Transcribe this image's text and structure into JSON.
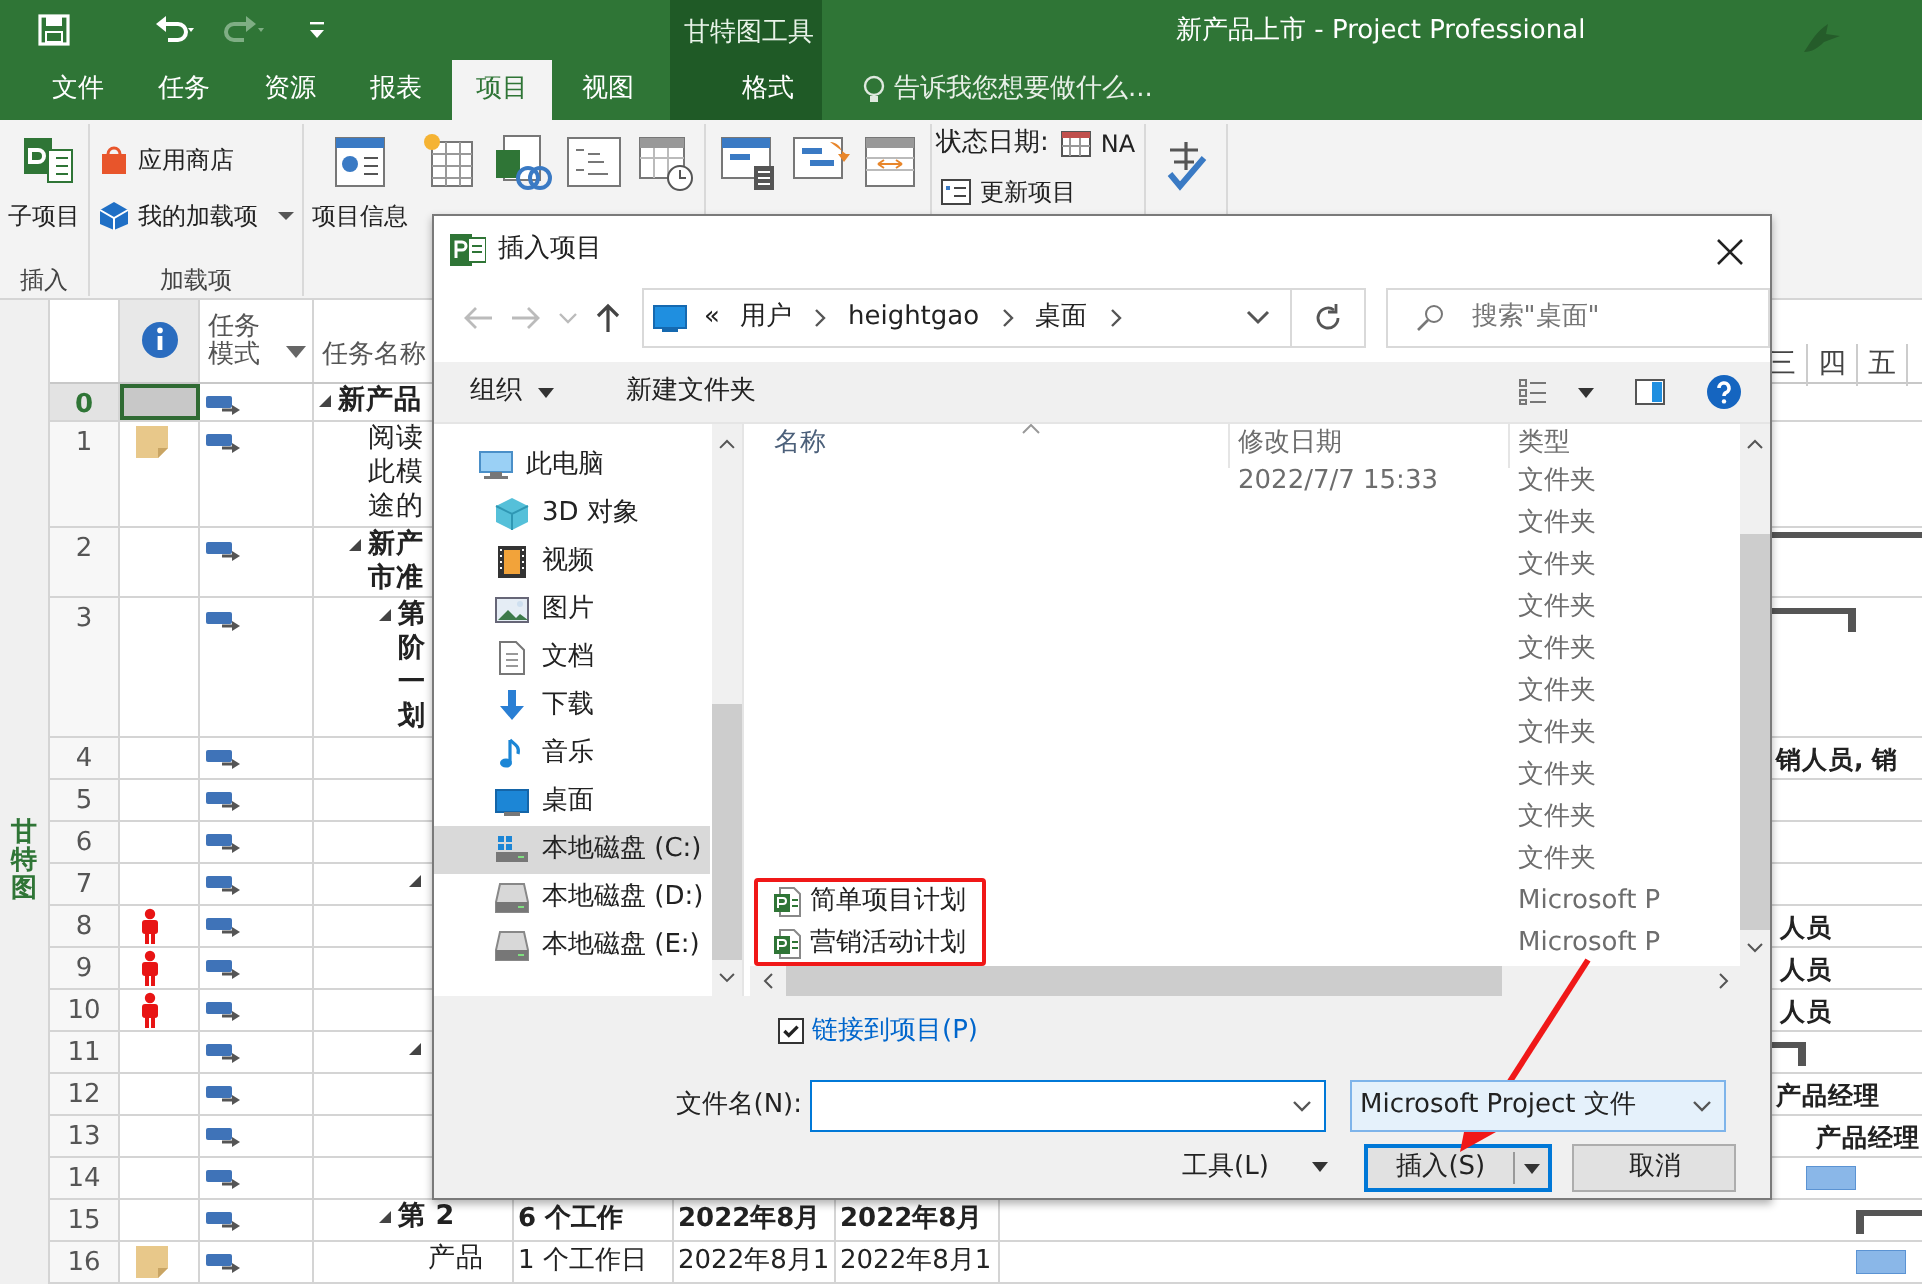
{
  "title_bar": {
    "context_label": "甘特图工具",
    "title": "新产品上市 - Project Professional"
  },
  "ribbon_tabs": [
    {
      "label": "文件",
      "selected": false,
      "kind": "file"
    },
    {
      "label": "任务",
      "selected": false,
      "kind": "normal"
    },
    {
      "label": "资源",
      "selected": false,
      "kind": "normal"
    },
    {
      "label": "报表",
      "selected": false,
      "kind": "normal"
    },
    {
      "label": "项目",
      "selected": true,
      "kind": "normal"
    },
    {
      "label": "视图",
      "selected": false,
      "kind": "normal"
    },
    {
      "label": "格式",
      "selected": false,
      "kind": "contextual"
    }
  ],
  "tell_me": "告诉我您想要做什么...",
  "ribbon_groups": [
    {
      "label": "插入",
      "items": [
        {
          "kind": "large",
          "label": "子项目"
        }
      ]
    },
    {
      "label": "加载项",
      "items": [
        {
          "kind": "small",
          "label": "应用商店"
        },
        {
          "kind": "small-dropdown",
          "label": "我的加载项"
        }
      ]
    },
    {
      "items": [
        {
          "kind": "large",
          "label": "项目信息"
        },
        {
          "kind": "large"
        },
        {
          "kind": "large"
        },
        {
          "kind": "large"
        },
        {
          "kind": "large"
        }
      ]
    },
    {
      "items": [
        {
          "kind": "large"
        },
        {
          "kind": "large"
        },
        {
          "kind": "large"
        }
      ]
    },
    {
      "items": [
        {
          "kind": "status-date",
          "label": "状态日期:",
          "value": "NA"
        },
        {
          "kind": "small",
          "label": "更新项目"
        }
      ]
    },
    {
      "items": [
        {
          "kind": "large"
        }
      ]
    }
  ],
  "view_label": "甘特图",
  "sheet": {
    "columns": [
      {
        "kind": "info"
      },
      {
        "kind": "text",
        "label": "任务模式"
      },
      {
        "kind": "text",
        "label": "任务名称"
      }
    ],
    "rows": [
      {
        "id": "0",
        "selected": true,
        "kind": "summary",
        "name": "新产品",
        "children": [
          {
            "id": "1",
            "selected": false,
            "kind": "task",
            "note": true,
            "name": "阅读此模途的"
          },
          {
            "id": "2",
            "selected": false,
            "kind": "summary",
            "name": "新产市准",
            "gantt_bar": true,
            "children": [
              {
                "id": "3",
                "selected": false,
                "kind": "summary",
                "name": "第阶一划",
                "gantt_bar": true,
                "children": [
                  {
                    "id": "4",
                    "selected": false,
                    "kind": "task",
                    "gantt_label": "销人员, 销"
                  },
                  {
                    "id": "5",
                    "selected": false,
                    "kind": "task"
                  },
                  {
                    "id": "6",
                    "selected": false,
                    "kind": "task"
                  },
                  {
                    "id": "7",
                    "selected": false,
                    "kind": "summary",
                    "children": [
                      {
                        "id": "8",
                        "selected": false,
                        "kind": "task",
                        "overallocated": true,
                        "gantt_label": "人员"
                      },
                      {
                        "id": "9",
                        "selected": false,
                        "kind": "task",
                        "overallocated": true,
                        "gantt_label": "人员"
                      },
                      {
                        "id": "10",
                        "selected": false,
                        "kind": "task",
                        "overallocated": true,
                        "gantt_label": "人员"
                      }
                    ]
                  },
                  {
                    "id": "11",
                    "selected": false,
                    "kind": "summary",
                    "gantt_bar": true,
                    "children": [
                      {
                        "id": "12",
                        "selected": false,
                        "kind": "task",
                        "gantt_label": "产品经理"
                      },
                      {
                        "id": "13",
                        "selected": false,
                        "kind": "task",
                        "gantt_label": "产品经理"
                      },
                      {
                        "id": "14",
                        "selected": false,
                        "kind": "task",
                        "gantt_bar": true
                      }
                    ]
                  }
                ]
              },
              {
                "id": "15",
                "selected": false,
                "kind": "summary",
                "name": "第 2",
                "duration": "6 个工作",
                "start": "2022年8月",
                "finish": "2022年8月",
                "gantt_bar": true,
                "children": [
                  {
                    "id": "16",
                    "selected": false,
                    "kind": "task",
                    "note": true,
                    "name": "产品",
                    "duration": "1 个工作日",
                    "start": "2022年8月1",
                    "finish": "2022年8月1",
                    "gantt_bar": true
                  }
                ]
              }
            ]
          }
        ]
      }
    ]
  },
  "timescale_days": [
    "三",
    "四",
    "五"
  ],
  "dialog": {
    "title": "插入项目",
    "breadcrumb_overflow": "«",
    "breadcrumb": [
      "用户",
      "heightgao",
      "桌面"
    ],
    "search_placeholder": "搜索\"桌面\"",
    "organize": "组织",
    "new_folder": "新建文件夹",
    "nav_items": [
      {
        "label": "此电脑",
        "selected": false,
        "children": [
          {
            "label": "3D 对象",
            "selected": false
          },
          {
            "label": "视频",
            "selected": false
          },
          {
            "label": "图片",
            "selected": false
          },
          {
            "label": "文档",
            "selected": false
          },
          {
            "label": "下载",
            "selected": false
          },
          {
            "label": "音乐",
            "selected": false
          },
          {
            "label": "桌面",
            "selected": false
          },
          {
            "label": "本地磁盘 (C:)",
            "selected": true
          },
          {
            "label": "本地磁盘 (D:)",
            "selected": false
          },
          {
            "label": "本地磁盘 (E:)",
            "selected": false
          }
        ]
      }
    ],
    "columns": [
      "名称",
      "修改日期",
      "类型"
    ],
    "files": [
      {
        "kind": "folder",
        "date": "2022/7/7 15:33",
        "type": "文件夹",
        "highlighted": false
      },
      {
        "kind": "folder",
        "type": "文件夹",
        "highlighted": false
      },
      {
        "kind": "folder",
        "type": "文件夹",
        "highlighted": false
      },
      {
        "kind": "folder",
        "type": "文件夹",
        "highlighted": false
      },
      {
        "kind": "folder",
        "type": "文件夹",
        "highlighted": false
      },
      {
        "kind": "folder",
        "type": "文件夹",
        "highlighted": false
      },
      {
        "kind": "folder",
        "type": "文件夹",
        "highlighted": false
      },
      {
        "kind": "folder",
        "type": "文件夹",
        "highlighted": false
      },
      {
        "kind": "folder",
        "type": "文件夹",
        "highlighted": false
      },
      {
        "kind": "folder",
        "type": "文件夹",
        "highlighted": false
      },
      {
        "kind": "project",
        "name": "简单项目计划",
        "type": "Microsoft P",
        "highlighted": true
      },
      {
        "kind": "project",
        "name": "营销活动计划",
        "type": "Microsoft P",
        "highlighted": true
      }
    ],
    "link_to_project": {
      "label": "链接到项目(P)",
      "checked": true
    },
    "file_name_label": "文件名(N):",
    "file_type": "Microsoft Project 文件",
    "tools_button": "工具(L)",
    "insert_button": "插入(S)",
    "cancel_button": "取消",
    "pointer_arrow": true
  }
}
